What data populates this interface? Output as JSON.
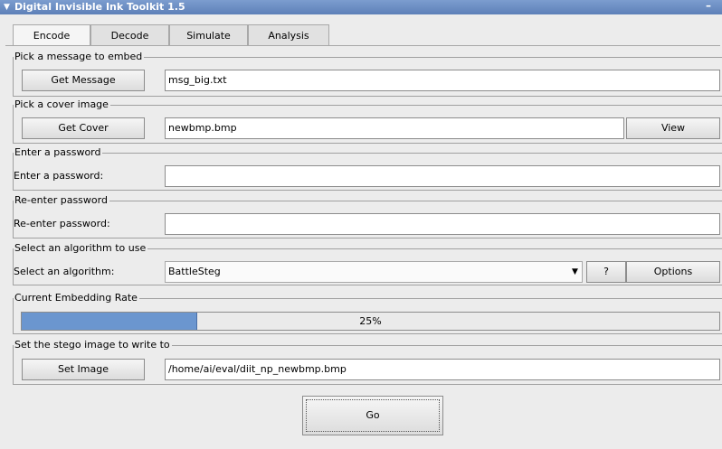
{
  "window": {
    "title": "Digital Invisible Ink Toolkit 1.5",
    "menu_icon": "triangle-down-icon",
    "minimize_icon": "minimize-icon",
    "minimize_glyph": "–"
  },
  "tabs": [
    {
      "label": "Encode",
      "active": true
    },
    {
      "label": "Decode",
      "active": false
    },
    {
      "label": "Simulate",
      "active": false
    },
    {
      "label": "Analysis",
      "active": false
    }
  ],
  "message_group": {
    "title": "Pick a message to embed",
    "button": "Get Message",
    "value": "msg_big.txt"
  },
  "cover_group": {
    "title": "Pick a cover image",
    "button": "Get Cover",
    "value": "newbmp.bmp",
    "view_button": "View"
  },
  "password_group": {
    "title": "Enter a password",
    "label": "Enter a password:",
    "value": ""
  },
  "reenter_group": {
    "title": "Re-enter password",
    "label": "Re-enter password:",
    "value": ""
  },
  "algorithm_group": {
    "title": "Select an algorithm to use",
    "label": "Select an algorithm:",
    "selected": "BattleSteg",
    "help_button": "?",
    "options_button": "Options"
  },
  "rate_group": {
    "title": "Current Embedding Rate",
    "progress_text": "25%",
    "progress_value": 25
  },
  "stego_group": {
    "title": "Set the stego image to write to",
    "button": "Set Image",
    "value": "/home/ai/eval/diit_np_newbmp.bmp"
  },
  "go_button": "Go",
  "colors": {
    "title_bar": "#5d80b8",
    "progress_fill": "#6b96cf",
    "background": "#ececec"
  }
}
